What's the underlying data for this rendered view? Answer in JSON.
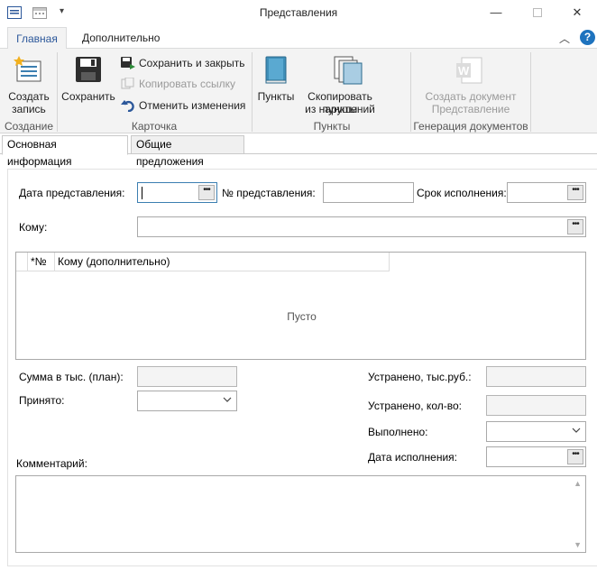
{
  "window": {
    "title": "Представления"
  },
  "ribbon_tabs": [
    "Главная",
    "Дополнительно"
  ],
  "ribbon": {
    "create": {
      "label_1": "Создать",
      "label_2": "запись",
      "group": "Создание"
    },
    "card": {
      "save": "Сохранить",
      "save_close": "Сохранить и закрыть",
      "copy_link": "Копировать ссылку",
      "cancel": "Отменить изменения",
      "group": "Карточка"
    },
    "points": {
      "points": "Пункты",
      "copy_1": "Скопировать пункты",
      "copy_2": "из нарушений",
      "group": "Пункты"
    },
    "docs": {
      "create_1": "Создать документ",
      "create_2": "Представление",
      "group": "Генерация документов"
    }
  },
  "content_tabs": [
    "Основная информация",
    "Общие предложения"
  ],
  "form": {
    "date_label": "Дата представления:",
    "date_value": "",
    "number_label": "№ представления:",
    "number_value": "",
    "deadline_label": "Срок исполнения:",
    "deadline_value": "",
    "to_label": "Кому:",
    "to_value": "",
    "grid": {
      "columns": [
        "*№",
        "Кому (дополнительно)"
      ],
      "empty_text": "Пусто"
    },
    "sum_label": "Сумма в тыс. (план):",
    "sum_value": "",
    "accepted_label": "Принято:",
    "accepted_value": "",
    "fixed_rub_label": "Устранено, тыс.руб.:",
    "fixed_rub_value": "",
    "fixed_count_label": "Устранено, кол-во:",
    "fixed_count_value": "",
    "done_label": "Выполнено:",
    "done_value": "",
    "exec_date_label": "Дата исполнения:",
    "exec_date_value": "",
    "comment_label": "Комментарий:",
    "comment_value": ""
  },
  "colors": {
    "accent": "#2b579a",
    "help": "#1e73be"
  }
}
